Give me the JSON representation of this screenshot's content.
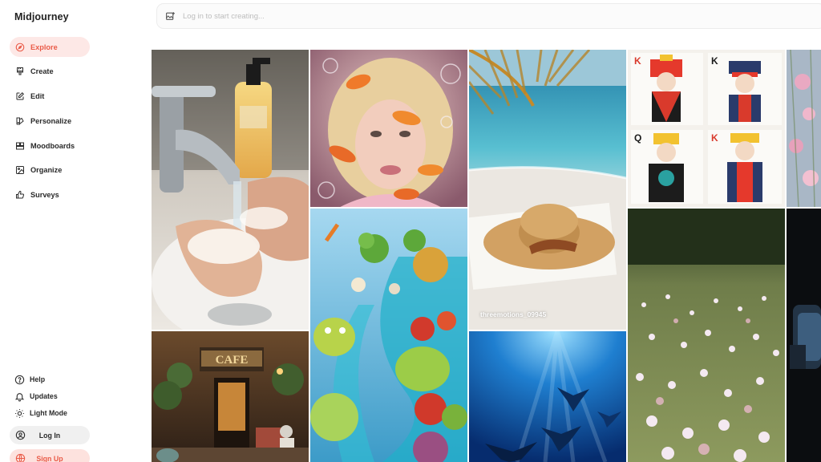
{
  "app": {
    "title": "Midjourney"
  },
  "sidebar": {
    "items": [
      {
        "label": "Explore",
        "icon": "compass-icon",
        "active": true
      },
      {
        "label": "Create",
        "icon": "brush-icon"
      },
      {
        "label": "Edit",
        "icon": "edit-icon"
      },
      {
        "label": "Personalize",
        "icon": "palette-icon"
      },
      {
        "label": "Moodboards",
        "icon": "moodboard-icon"
      },
      {
        "label": "Organize",
        "icon": "image-icon"
      },
      {
        "label": "Surveys",
        "icon": "thumbs-up-icon"
      }
    ],
    "bottom": {
      "help": "Help",
      "updates": "Updates",
      "light_mode": "Light Mode",
      "login": "Log In",
      "signup": "Sign Up"
    }
  },
  "search": {
    "placeholder": "Log in to start creating..."
  },
  "gallery": {
    "caption": "threemotions_09945",
    "tiles": [
      "hand-washing-image",
      "cafe-street-image",
      "goldfish-portrait-image",
      "vegetable-river-image",
      "beach-hat-image",
      "underwater-rays-image",
      "playing-cards-image",
      "wildflower-meadow-image",
      "pink-flowers-image",
      "dark-night-image"
    ]
  },
  "colors": {
    "accent": "#ea5b48",
    "active_bg": "#fde8e6",
    "signup_bg": "#fde2de"
  }
}
